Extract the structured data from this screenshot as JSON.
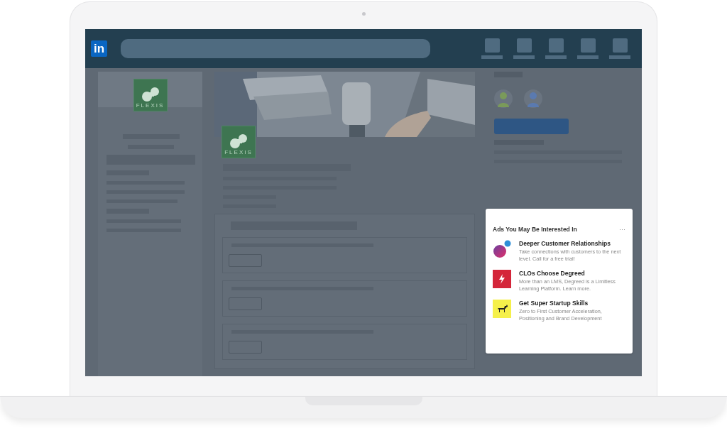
{
  "header": {
    "logo": "in"
  },
  "company_sidebar": {
    "logo_text": "FLEXIS"
  },
  "company_page": {
    "logo_text": "FLEXIS"
  },
  "ads_card": {
    "title": "Ads You May Be Interested In",
    "menu": "···",
    "ads": [
      {
        "kind": "orb",
        "title": "Deeper Customer Relationships",
        "description": "Take connections with customers to the next level. Call for a free trial!"
      },
      {
        "kind": "bolt",
        "title": "CLOs Choose Degreed",
        "description": "More than an LMS, Degreed is a Limitless Learning Platform. Learn more."
      },
      {
        "kind": "moose",
        "title": "Get Super Startup Skills",
        "description": "Zero to First Customer Acceleration, Positioning and Brand Development"
      }
    ]
  }
}
